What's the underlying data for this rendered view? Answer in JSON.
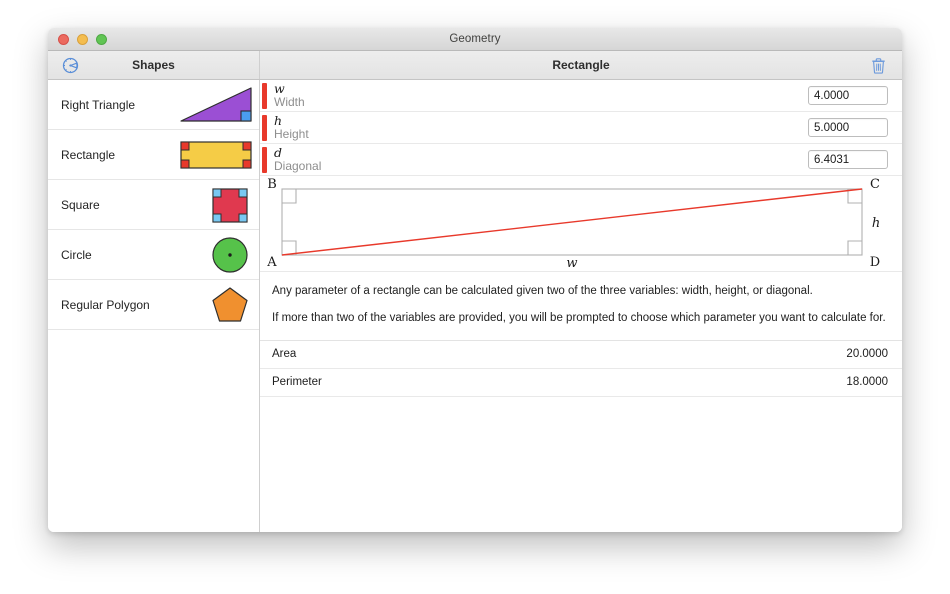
{
  "window": {
    "title": "Geometry",
    "traffic_lights": [
      "close-button",
      "minimize-button",
      "maximize-button"
    ]
  },
  "toolbar": {
    "protractor_icon": "protractor-icon",
    "sidebar_heading": "Shapes",
    "detail_heading": "Rectangle",
    "trash_icon": "trash-icon"
  },
  "sidebar": {
    "items": [
      {
        "label": "Right Triangle",
        "thumb": "right-triangle-thumb",
        "selected": false
      },
      {
        "label": "Rectangle",
        "thumb": "rectangle-thumb",
        "selected": true
      },
      {
        "label": "Square",
        "thumb": "square-thumb",
        "selected": false
      },
      {
        "label": "Circle",
        "thumb": "circle-thumb",
        "selected": false
      },
      {
        "label": "Regular Polygon",
        "thumb": "regular-polygon-thumb",
        "selected": false
      }
    ]
  },
  "detail": {
    "parameters": [
      {
        "symbol": "w",
        "name": "Width",
        "value": "4.0000"
      },
      {
        "symbol": "h",
        "name": "Height",
        "value": "5.0000"
      },
      {
        "symbol": "d",
        "name": "Diagonal",
        "value": "6.4031"
      }
    ],
    "diagram": {
      "vertex_top_left": "B",
      "vertex_top_right": "C",
      "vertex_bottom_left": "A",
      "vertex_bottom_right": "D",
      "width_label": "w",
      "height_label": "h",
      "diagonal_color": "#e8392b",
      "outline_color": "#b0b0b0"
    },
    "description": [
      "Any parameter of a rectangle can be calculated given two of the three variables: width, height, or diagonal.",
      "If more than two of the variables are provided, you will be prompted to choose which parameter you want to calculate for."
    ],
    "results": [
      {
        "label": "Area",
        "value": "20.0000"
      },
      {
        "label": "Perimeter",
        "value": "18.0000"
      }
    ]
  },
  "colors": {
    "accent_red": "#e8392b",
    "toolbar_icon_blue": "#5b8fd8",
    "triangle_purple": "#9b4fd4",
    "rectangle_gold": "#f5cc46",
    "square_crimson": "#e0394f",
    "circle_green": "#56c24a",
    "pentagon_orange": "#f0902f",
    "marker_blue": "#4a9ef0"
  }
}
